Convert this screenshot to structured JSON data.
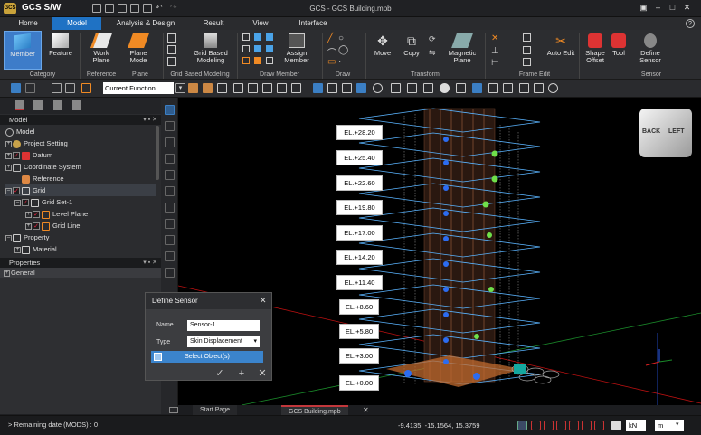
{
  "window": {
    "logo_text": "GCS",
    "app_name": "GCS S/W",
    "title": "GCS - GCS Building.mpb",
    "help": "?"
  },
  "menu": [
    "Home",
    "Model",
    "Analysis & Design",
    "Result",
    "View",
    "Interface"
  ],
  "ribbon": {
    "buttons": {
      "member": "Member",
      "feature": "Feature",
      "work_plane": "Work Plane",
      "plane_mode": "Plane Mode",
      "grid_based_modeling": "Grid Based Modeling",
      "assign_member": "Assign Member",
      "move": "Move",
      "copy": "Copy",
      "magnetic_plane": "Magnetic Plane",
      "auto_edit": "Auto Edit",
      "shape_offset": "Shape Offset",
      "tool": "Tool",
      "define_sensor": "Define Sensor"
    },
    "groups": {
      "category": "Category",
      "reference": "Reference",
      "plane": "Plane",
      "grid_based_modeling": "Grid Based Modeling",
      "draw_member": "Draw Member",
      "draw": "Draw",
      "transform": "Transform",
      "frame_edit": "Frame Edit",
      "sensor": "Sensor"
    }
  },
  "toolbar": {
    "current_function": "Current Function"
  },
  "model_panel": {
    "title": "Model",
    "tree": [
      {
        "label": "Model"
      },
      {
        "label": "Project Setting"
      },
      {
        "label": "Datum"
      },
      {
        "label": "Coordinate System"
      },
      {
        "label": "Reference"
      },
      {
        "label": "Grid"
      },
      {
        "label": "Grid Set-1"
      },
      {
        "label": "Level Plane"
      },
      {
        "label": "Grid Line"
      },
      {
        "label": "Property"
      },
      {
        "label": "Material"
      }
    ]
  },
  "properties_panel": {
    "title": "Properties",
    "section": "General"
  },
  "viewport": {
    "levels": [
      "EL.+28.20",
      "EL.+25.40",
      "EL.+22.60",
      "EL.+19.80",
      "EL.+17.00",
      "EL.+14.20",
      "EL.+11.40",
      "EL.+8.60",
      "EL.+5.80",
      "EL.+3.00",
      "EL.+0.00"
    ],
    "nav_cube": {
      "back": "BACK",
      "left": "LEFT"
    }
  },
  "dialog": {
    "title": "Define Sensor",
    "name_label": "Name",
    "name_value": "Sensor-1",
    "type_label": "Type",
    "type_value": "Skin Displacement",
    "select_objects": "Select Object(s)"
  },
  "doc_tabs": [
    "Start Page",
    "GCS Building.mpb"
  ],
  "status": {
    "remaining": "> Remaining date (MODS) : 0",
    "coords": "-9.4135, -15.1564, 15.3759",
    "force_unit": "kN",
    "length_unit": "m"
  }
}
